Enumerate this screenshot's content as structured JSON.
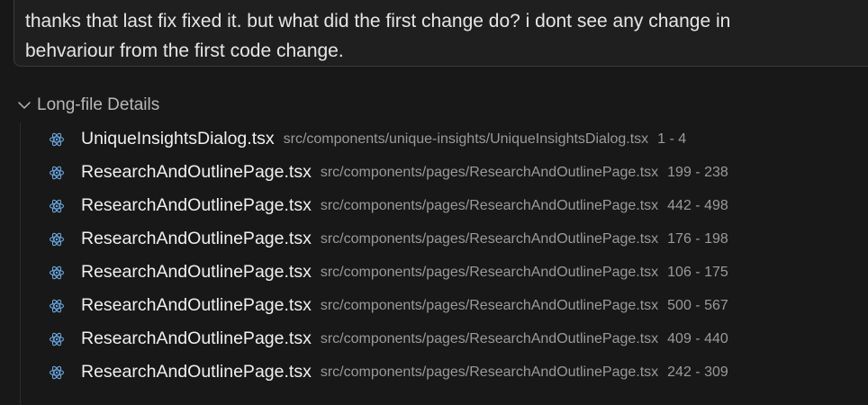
{
  "chat": {
    "user_message": "thanks that last fix fixed it. but what did the first change do? i dont see any change in\nbehvariour from the first code change."
  },
  "details": {
    "title": "Long-file Details",
    "expanded_icon": "chevron-down-icon",
    "file_icon": "react-icon",
    "icon_color": "#6aa7e0",
    "files": [
      {
        "name": "UniqueInsightsDialog.tsx",
        "path": "src/components/unique-insights/UniqueInsightsDialog.tsx",
        "range": "1 - 4"
      },
      {
        "name": "ResearchAndOutlinePage.tsx",
        "path": "src/components/pages/ResearchAndOutlinePage.tsx",
        "range": "199 - 238"
      },
      {
        "name": "ResearchAndOutlinePage.tsx",
        "path": "src/components/pages/ResearchAndOutlinePage.tsx",
        "range": "442 - 498"
      },
      {
        "name": "ResearchAndOutlinePage.tsx",
        "path": "src/components/pages/ResearchAndOutlinePage.tsx",
        "range": "176 - 198"
      },
      {
        "name": "ResearchAndOutlinePage.tsx",
        "path": "src/components/pages/ResearchAndOutlinePage.tsx",
        "range": "106 - 175"
      },
      {
        "name": "ResearchAndOutlinePage.tsx",
        "path": "src/components/pages/ResearchAndOutlinePage.tsx",
        "range": "500 - 567"
      },
      {
        "name": "ResearchAndOutlinePage.tsx",
        "path": "src/components/pages/ResearchAndOutlinePage.tsx",
        "range": "409 - 440"
      },
      {
        "name": "ResearchAndOutlinePage.tsx",
        "path": "src/components/pages/ResearchAndOutlinePage.tsx",
        "range": "242 - 309"
      }
    ]
  }
}
